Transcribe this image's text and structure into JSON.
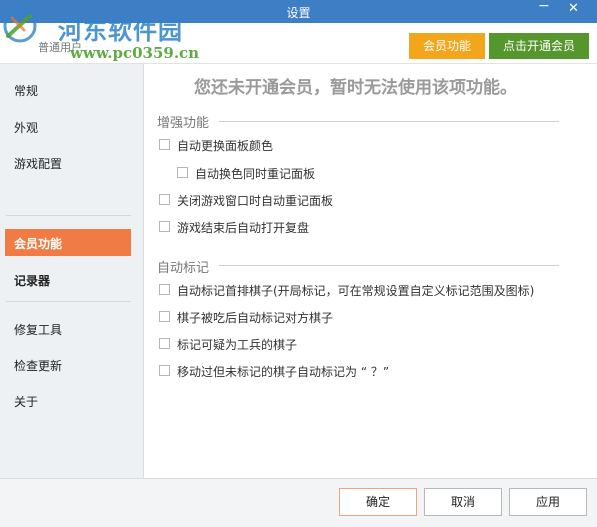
{
  "window": {
    "title": "设置",
    "minimize_glyph": "−",
    "close_glyph": "✕"
  },
  "watermark": {
    "name": "河东软件园",
    "url": "www.pc0359.cn"
  },
  "topbar": {
    "user_label": "普通用户",
    "member_button": "会员功能",
    "open_member_button": "点击开通会员"
  },
  "sidebar": {
    "items": [
      {
        "label": "常规"
      },
      {
        "label": "外观"
      },
      {
        "label": "游戏配置"
      },
      {
        "label": "会员功能",
        "active": true
      },
      {
        "label": "记录器"
      },
      {
        "label": "修复工具"
      },
      {
        "label": "检查更新"
      },
      {
        "label": "关于"
      }
    ]
  },
  "content": {
    "notice": "您还未开通会员，暂时无法使用该项功能。",
    "section1": {
      "title": "增强功能",
      "options": [
        {
          "label": "自动更换面板颜色",
          "checked": false
        },
        {
          "label": "自动换色同时重记面板",
          "checked": false
        },
        {
          "label": "关闭游戏窗口时自动重记面板",
          "checked": false
        },
        {
          "label": "游戏结束后自动打开复盘",
          "checked": false
        }
      ]
    },
    "section2": {
      "title": "自动标记",
      "options": [
        {
          "label": "自动标记首排棋子(开局标记，可在常规设置自定义标记范围及图标)",
          "checked": false
        },
        {
          "label": "棋子被吃后自动标记对方棋子",
          "checked": false
        },
        {
          "label": "标记可疑为工兵的棋子",
          "checked": false
        },
        {
          "label": "移动过但未标记的棋子自动标记为 “ ？”",
          "checked": false
        }
      ]
    }
  },
  "footer": {
    "ok": "确定",
    "cancel": "取消",
    "apply": "应用"
  },
  "colors": {
    "titlebar": "#3e7ec5",
    "member_button": "#f3a51b",
    "open_member_button": "#55962d",
    "sidebar_active": "#f07b45",
    "sidebar_bg": "#eef1f4",
    "footer_bg": "#f2f4f6"
  },
  "icons": [
    "app-logo-icon",
    "minimize-icon",
    "close-icon",
    "checkbox-icon"
  ]
}
